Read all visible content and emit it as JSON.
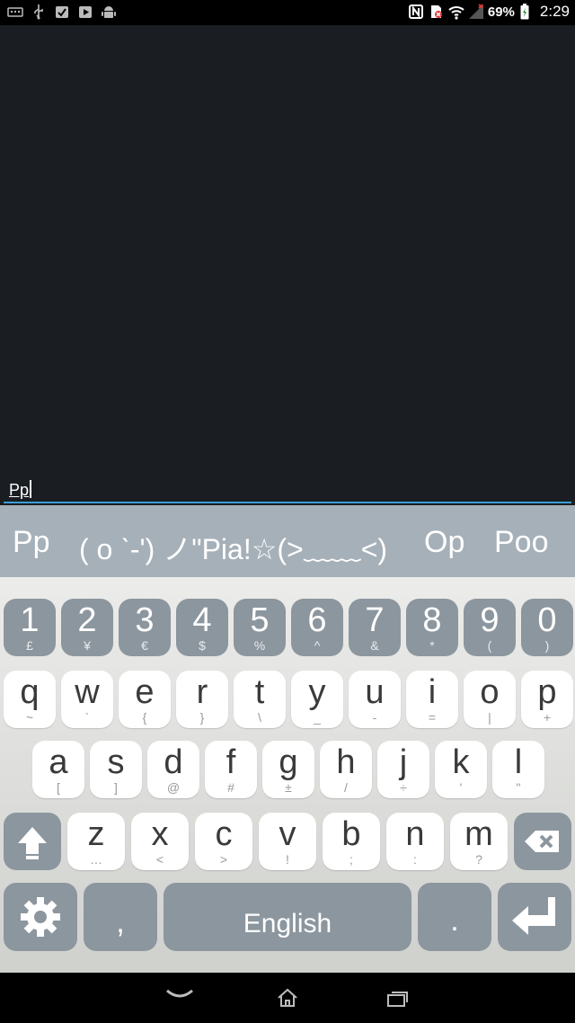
{
  "status_bar": {
    "battery_percent": "69%",
    "time": "2:29"
  },
  "editor": {
    "text": "Pp"
  },
  "suggestions": [
    "Pp",
    "( o ˋ-') ノ\"Pia!☆(>﹏﹏<)",
    "Op",
    "Poo"
  ],
  "keyboard": {
    "numbers": [
      {
        "main": "1",
        "sub": "£"
      },
      {
        "main": "2",
        "sub": "¥"
      },
      {
        "main": "3",
        "sub": "€"
      },
      {
        "main": "4",
        "sub": "$"
      },
      {
        "main": "5",
        "sub": "%"
      },
      {
        "main": "6",
        "sub": "^"
      },
      {
        "main": "7",
        "sub": "&"
      },
      {
        "main": "8",
        "sub": "*"
      },
      {
        "main": "9",
        "sub": "("
      },
      {
        "main": "0",
        "sub": ")"
      }
    ],
    "row1": [
      {
        "main": "q",
        "sub": "~"
      },
      {
        "main": "w",
        "sub": "`"
      },
      {
        "main": "e",
        "sub": "{"
      },
      {
        "main": "r",
        "sub": "}"
      },
      {
        "main": "t",
        "sub": "\\"
      },
      {
        "main": "y",
        "sub": "_"
      },
      {
        "main": "u",
        "sub": "-"
      },
      {
        "main": "i",
        "sub": "="
      },
      {
        "main": "o",
        "sub": "|"
      },
      {
        "main": "p",
        "sub": "+"
      }
    ],
    "row2": [
      {
        "main": "a",
        "sub": "["
      },
      {
        "main": "s",
        "sub": "]"
      },
      {
        "main": "d",
        "sub": "@"
      },
      {
        "main": "f",
        "sub": "#"
      },
      {
        "main": "g",
        "sub": "±"
      },
      {
        "main": "h",
        "sub": "/"
      },
      {
        "main": "j",
        "sub": "÷"
      },
      {
        "main": "k",
        "sub": "'"
      },
      {
        "main": "l",
        "sub": "\""
      }
    ],
    "row3": [
      {
        "main": "z",
        "sub": "…"
      },
      {
        "main": "x",
        "sub": "<"
      },
      {
        "main": "c",
        "sub": ">"
      },
      {
        "main": "v",
        "sub": "!"
      },
      {
        "main": "b",
        "sub": ";"
      },
      {
        "main": "n",
        "sub": ":"
      },
      {
        "main": "m",
        "sub": "?"
      }
    ],
    "comma": ",",
    "space": "English",
    "period": "."
  },
  "colors": {
    "editor_bg": "#1a1d21",
    "accent": "#3aa0d8",
    "suggestion_bg": "#a6b0b8",
    "function_key": "#8c969e"
  }
}
